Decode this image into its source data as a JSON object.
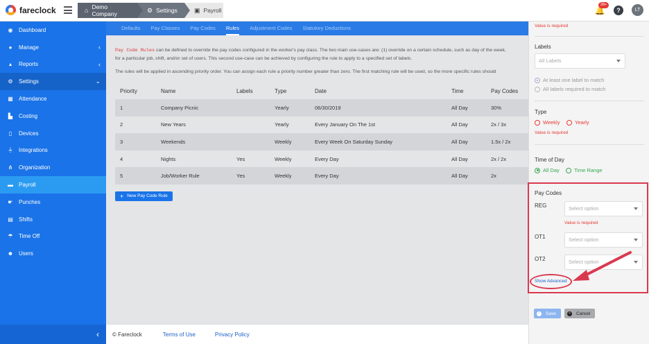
{
  "app": {
    "logo_text": "fareclock"
  },
  "breadcrumbs": [
    {
      "label": "Demo Company",
      "icon": "home-icon"
    },
    {
      "label": "Settings",
      "icon": "gear-icon"
    },
    {
      "label": "Payroll",
      "icon": "payroll-icon"
    }
  ],
  "header": {
    "notification_count": "28+",
    "help_label": "?",
    "avatar_initials": "LT"
  },
  "sidebar": {
    "items": [
      {
        "label": "Dashboard",
        "icon": "dashboard-icon"
      },
      {
        "label": "Manage",
        "icon": "user-icon",
        "chevron": "‹"
      },
      {
        "label": "Reports",
        "icon": "chart-icon",
        "chevron": "‹"
      },
      {
        "label": "Settings",
        "icon": "gear-icon",
        "chevron": "⌄"
      },
      {
        "label": "Attendance",
        "icon": "attendance-icon"
      },
      {
        "label": "Costing",
        "icon": "costing-icon"
      },
      {
        "label": "Devices",
        "icon": "device-icon"
      },
      {
        "label": "Integrations",
        "icon": "plug-icon"
      },
      {
        "label": "Organization",
        "icon": "org-icon"
      },
      {
        "label": "Payroll",
        "icon": "payroll-icon"
      },
      {
        "label": "Punches",
        "icon": "punch-icon"
      },
      {
        "label": "Shifts",
        "icon": "shift-icon"
      },
      {
        "label": "Time Off",
        "icon": "beach-icon"
      },
      {
        "label": "Users",
        "icon": "users-icon"
      }
    ],
    "collapse_label": "‹"
  },
  "tabs": [
    "Defaults",
    "Pay Classes",
    "Pay Codes",
    "Rules",
    "Adjustment Codes",
    "Statutory Deductions"
  ],
  "intro": {
    "code_term": "Pay Code Rules",
    "line1": " can be defined to override the pay codes configured in the worker's pay class. The two main use-cases are: (1) override on a certain schedule, such as day of the week,",
    "line2": "for a particular job, shift, and/or set of users. This second use-case can be achieved by configuring the rule to apply to a specified set of labels.",
    "line3": "The rules will be applied in ascending priority order. You can assign each rule a priority number greater than zero. The first matching rule will be used, so the more specific rules should"
  },
  "table": {
    "headers": [
      "Priority",
      "Name",
      "Labels",
      "Type",
      "Date",
      "Time",
      "Pay Codes"
    ],
    "rows": [
      [
        "1",
        "Company Picnic",
        "",
        "Yearly",
        "06/30/2019",
        "All Day",
        "30%"
      ],
      [
        "2",
        "New Years",
        "",
        "Yearly",
        "Every January On The 1st",
        "All Day",
        "2x / 3x"
      ],
      [
        "3",
        "Weekends",
        "",
        "Weekly",
        "Every Week On Saturday Sunday",
        "All Day",
        "1.5x / 2x"
      ],
      [
        "4",
        "Nights",
        "Yes",
        "Weekly",
        "Every Day",
        "All Day",
        "2x / 2x"
      ],
      [
        "5",
        "Job/Worker Rule",
        "Yes",
        "Weekly",
        "Every Day",
        "All Day",
        "2x"
      ]
    ]
  },
  "new_rule_button": "New Pay Code Rule",
  "footer": {
    "copyright": "© Fareclock",
    "terms": "Terms of Use",
    "privacy": "Privacy Policy"
  },
  "panel": {
    "top_required": "Value is required",
    "labels_title": "Labels",
    "labels_placeholder": "All Labels",
    "match_any": "At least one label to match",
    "match_all": "All labels required to match",
    "type_title": "Type",
    "type_weekly": "Weekly",
    "type_yearly": "Yearly",
    "type_required": "Value is required",
    "tod_title": "Time of Day",
    "tod_all_day": "All Day",
    "tod_range": "Time Range",
    "paycodes_title": "Pay Codes",
    "reg_label": "REG",
    "reg_placeholder": "Select option",
    "reg_required": "Value is required",
    "ot1_label": "OT1",
    "ot1_placeholder": "Select option",
    "ot2_label": "OT2",
    "ot2_placeholder": "Select option",
    "show_advanced": "Show Advanced",
    "save": "Save",
    "cancel": "Cancel"
  },
  "colors": {
    "primary": "#1a73e8",
    "sidebar_active": "#2b9bf2",
    "error": "#e53935",
    "annotation": "#d9394f",
    "success": "#35a853"
  }
}
